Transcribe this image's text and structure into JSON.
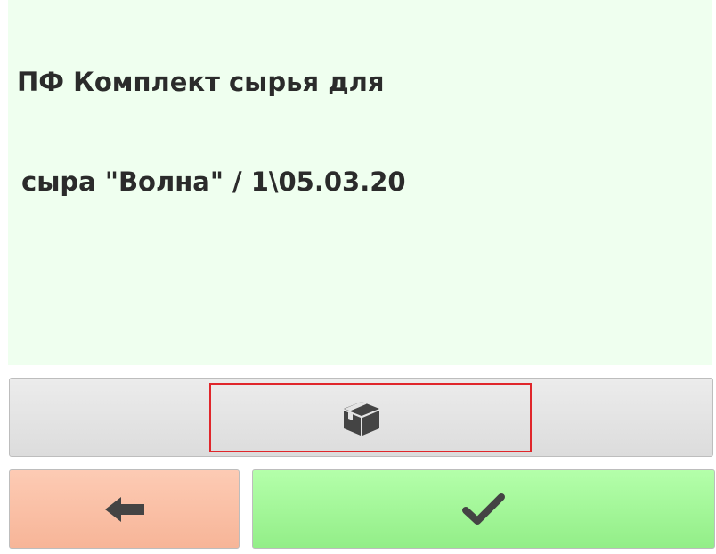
{
  "item": {
    "title_line1": "ПФ Комплект сырья для",
    "title_line2": "сыра \"Волна\" / 1\\05.03.20"
  },
  "buttons": {
    "package": {
      "icon": "box-icon",
      "color": "#e4e4e4"
    },
    "back": {
      "icon": "arrow-left-icon",
      "color": "#f9bfa5"
    },
    "confirm": {
      "icon": "checkmark-icon",
      "color": "#a3f597"
    }
  },
  "colors": {
    "panel_background": "#efffef",
    "highlight": "#e0262b",
    "icon": "#444444"
  }
}
